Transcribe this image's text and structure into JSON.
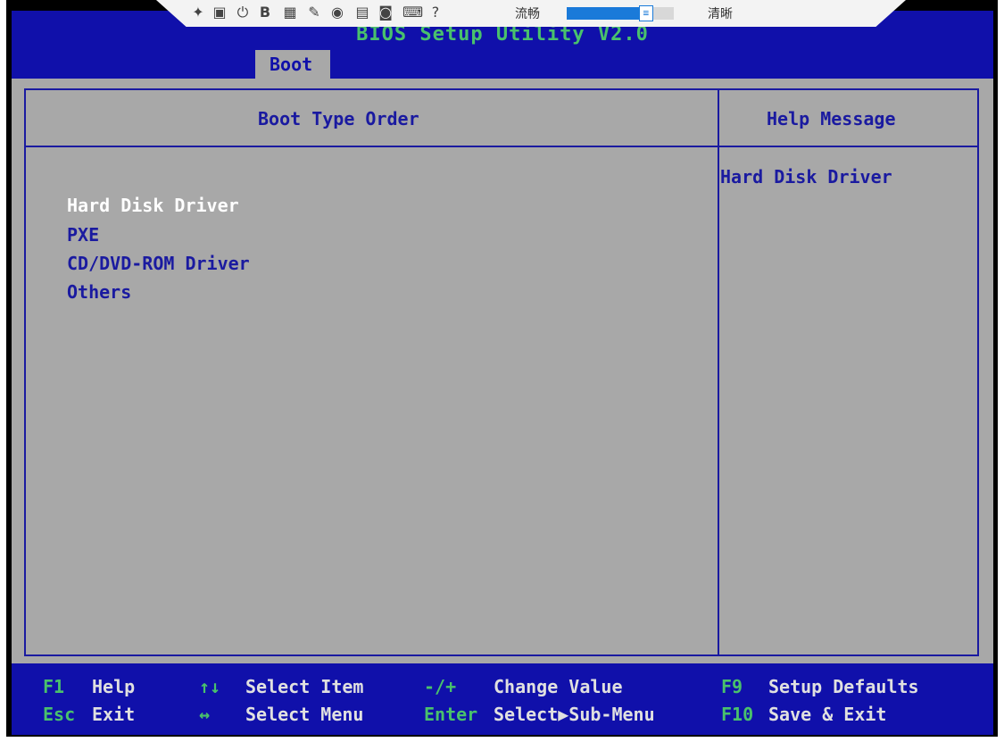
{
  "toolbar": {
    "icons": [
      "pin-icon",
      "image-icon",
      "power-icon",
      "b-icon",
      "screen-icon",
      "tool-icon",
      "record-icon",
      "save-icon",
      "video-icon",
      "keyboard-icon",
      "help-icon"
    ],
    "label_smooth": "流畅",
    "label_clear": "清晰",
    "quality_value": 0.74
  },
  "bios": {
    "title": "BIOS Setup Utility V2.0",
    "tab": "Boot",
    "left_header": "Boot Type Order",
    "right_header": "Help Message",
    "items": [
      {
        "label": "Hard Disk Driver",
        "selected": true
      },
      {
        "label": "PXE",
        "selected": false
      },
      {
        "label": "CD/DVD-ROM Driver",
        "selected": false
      },
      {
        "label": "Others",
        "selected": false
      }
    ],
    "help_text": "Hard Disk Driver"
  },
  "footer": {
    "f1_key": "F1",
    "f1_desc": "Help",
    "esc_key": "Esc",
    "esc_desc": "Exit",
    "ud_key": "↑↓",
    "ud_desc": "Select Item",
    "lr_key": "↔",
    "lr_desc": "Select Menu",
    "pm_key": "-/+",
    "pm_desc": "Change Value",
    "enter_key": "Enter",
    "enter_desc": "Select▶Sub-Menu",
    "f9_key": "F9",
    "f9_desc": "Setup Defaults",
    "f10_key": "F10",
    "f10_desc": "Save & Exit"
  },
  "colors": {
    "blue": "#1010aa",
    "grey": "#a8a8a8",
    "green_key": "#49c16c",
    "accent_slider": "#1a7ad9"
  }
}
